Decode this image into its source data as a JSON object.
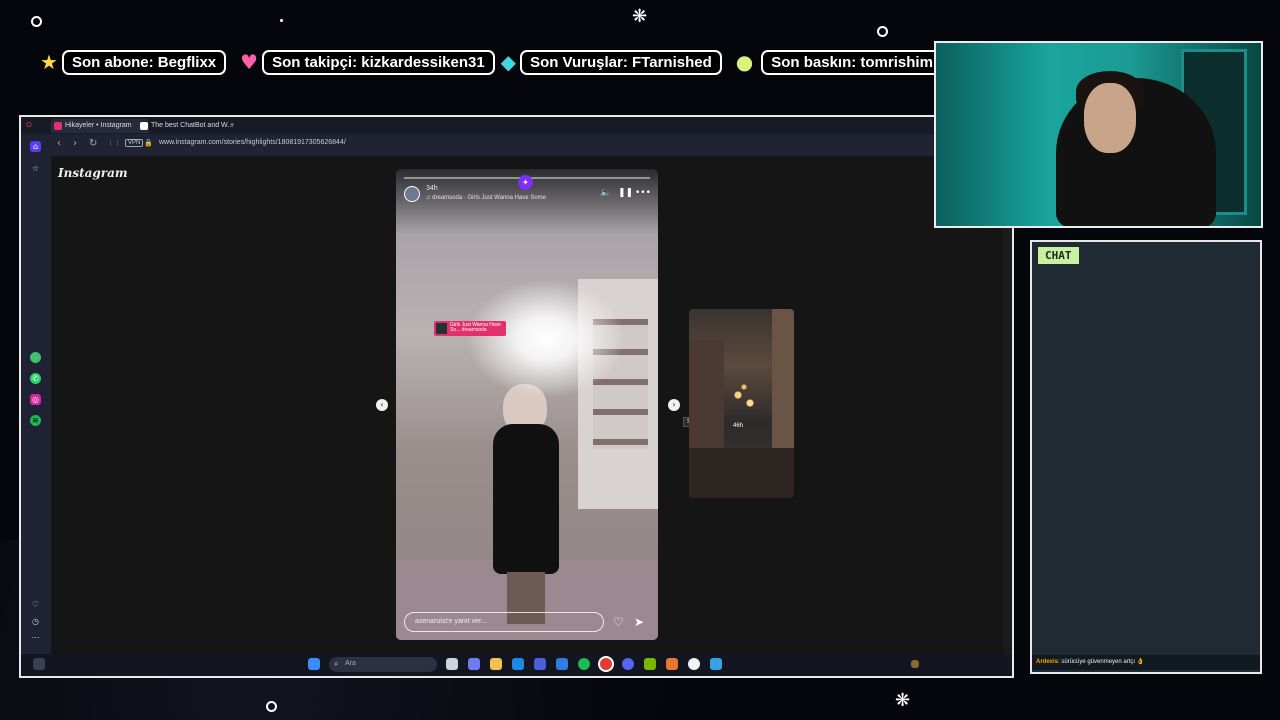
{
  "overlay": {
    "stats": [
      {
        "icon": "star-icon",
        "glyph": "★",
        "label": "Son abone: Begflixx",
        "boxed": true
      },
      {
        "icon": "heart-icon",
        "glyph": "♥",
        "label": "Son takipçi: kizkardessiken31",
        "boxed": true
      },
      {
        "icon": "gem-icon",
        "glyph": "◆",
        "label": "Son Vuruşlar: FTarnished",
        "boxed": true
      },
      {
        "icon": "coin-icon",
        "glyph": "●",
        "label": "Son baskın: tomrishim",
        "boxed": true
      }
    ],
    "colors": {
      "background": "#05060b",
      "heart": "#ff5fa8",
      "gem": "#40d7e0",
      "coin": "#d9f27a"
    }
  },
  "browser": {
    "tabs": [
      {
        "label": "Hikayeler • Instagram",
        "favicon_color": "#e1306c"
      },
      {
        "label": "The best ChatBot and W...",
        "favicon_color": "#ffffff"
      }
    ],
    "new_tab_glyph": "+",
    "vpn_label": "VPN",
    "url": "www.instagram.com/stories/highlights/18081917305626844/"
  },
  "instagram": {
    "logo": "Instagram",
    "story": {
      "time": "34h",
      "audio": "♫ dreamsoda · Girls Just Wanna Have Some",
      "sticker": "Girls Just Wanna Have So... dreamsoda",
      "reply_placeholder": "asenaruist'e yanıt ver...",
      "fab_glyph": "✦"
    },
    "next": {
      "tooltip": "Sonraki",
      "time": "46h"
    }
  },
  "taskbar": {
    "search_placeholder": "Ara"
  },
  "chat": {
    "title": "CHAT",
    "messages": [
      {
        "user": "Ardexis",
        "text": ": sürücüye güvenmeyen artçı 👌"
      }
    ]
  }
}
